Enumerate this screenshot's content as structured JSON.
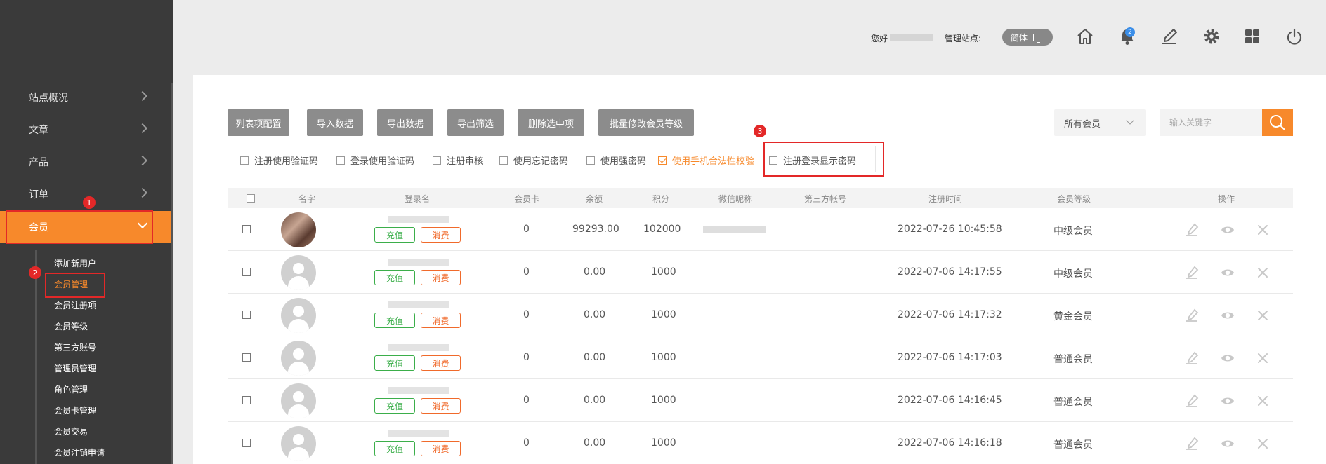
{
  "sidebar": {
    "items": [
      {
        "label": "站点概况"
      },
      {
        "label": "文章"
      },
      {
        "label": "产品"
      },
      {
        "label": "订单"
      },
      {
        "label": "会员"
      }
    ],
    "submenu": [
      {
        "label": "添加新用户"
      },
      {
        "label": "会员管理"
      },
      {
        "label": "会员注册项"
      },
      {
        "label": "会员等级"
      },
      {
        "label": "第三方账号"
      },
      {
        "label": "管理员管理"
      },
      {
        "label": "角色管理"
      },
      {
        "label": "会员卡管理"
      },
      {
        "label": "会员交易"
      },
      {
        "label": "会员注销申请"
      }
    ]
  },
  "annotations": {
    "one": "1",
    "two": "2",
    "three": "3"
  },
  "header": {
    "greeting": "您好",
    "site_label": "管理站点:",
    "lang": "简体",
    "notification_count": "2",
    "icons": [
      "home-icon",
      "bell-icon",
      "edit-icon",
      "gear-icon",
      "grid-icon",
      "power-icon"
    ]
  },
  "toolbar": {
    "buttons": [
      {
        "label": "列表项配置"
      },
      {
        "label": "导入数据"
      },
      {
        "label": "导出数据"
      },
      {
        "label": "导出筛选"
      },
      {
        "label": "删除选中项"
      },
      {
        "label": "批量修改会员等级"
      }
    ],
    "filter_select": "所有会员",
    "search_placeholder": "输入关键字"
  },
  "options": [
    {
      "label": "注册使用验证码",
      "checked": false
    },
    {
      "label": "登录使用验证码",
      "checked": false
    },
    {
      "label": "注册审核",
      "checked": false
    },
    {
      "label": "使用忘记密码",
      "checked": false
    },
    {
      "label": "使用强密码",
      "checked": false
    },
    {
      "label": "使用手机合法性校验",
      "checked": true
    },
    {
      "label": "注册登录显示密码",
      "checked": false
    }
  ],
  "table": {
    "columns": [
      "名字",
      "登录名",
      "会员卡",
      "余额",
      "积分",
      "微信昵称",
      "第三方帐号",
      "注册时间",
      "会员等级",
      "操作"
    ],
    "recharge_label": "充值",
    "consume_label": "消费",
    "rows": [
      {
        "card": "0",
        "balance": "99293.00",
        "points": "102000",
        "reg_time": "2022-07-26 10:45:58",
        "level": "中级会员"
      },
      {
        "card": "0",
        "balance": "0.00",
        "points": "1000",
        "reg_time": "2022-07-06 14:17:55",
        "level": "中级会员"
      },
      {
        "card": "0",
        "balance": "0.00",
        "points": "1000",
        "reg_time": "2022-07-06 14:17:32",
        "level": "黄金会员"
      },
      {
        "card": "0",
        "balance": "0.00",
        "points": "1000",
        "reg_time": "2022-07-06 14:17:03",
        "level": "普通会员"
      },
      {
        "card": "0",
        "balance": "0.00",
        "points": "1000",
        "reg_time": "2022-07-06 14:16:45",
        "level": "普通会员"
      },
      {
        "card": "0",
        "balance": "0.00",
        "points": "1000",
        "reg_time": "2022-07-06 14:16:18",
        "level": "普通会员"
      }
    ]
  },
  "colors": {
    "accent": "#f7892b",
    "sidebar_bg": "#3a3a3a",
    "highlight": "#e32828"
  }
}
